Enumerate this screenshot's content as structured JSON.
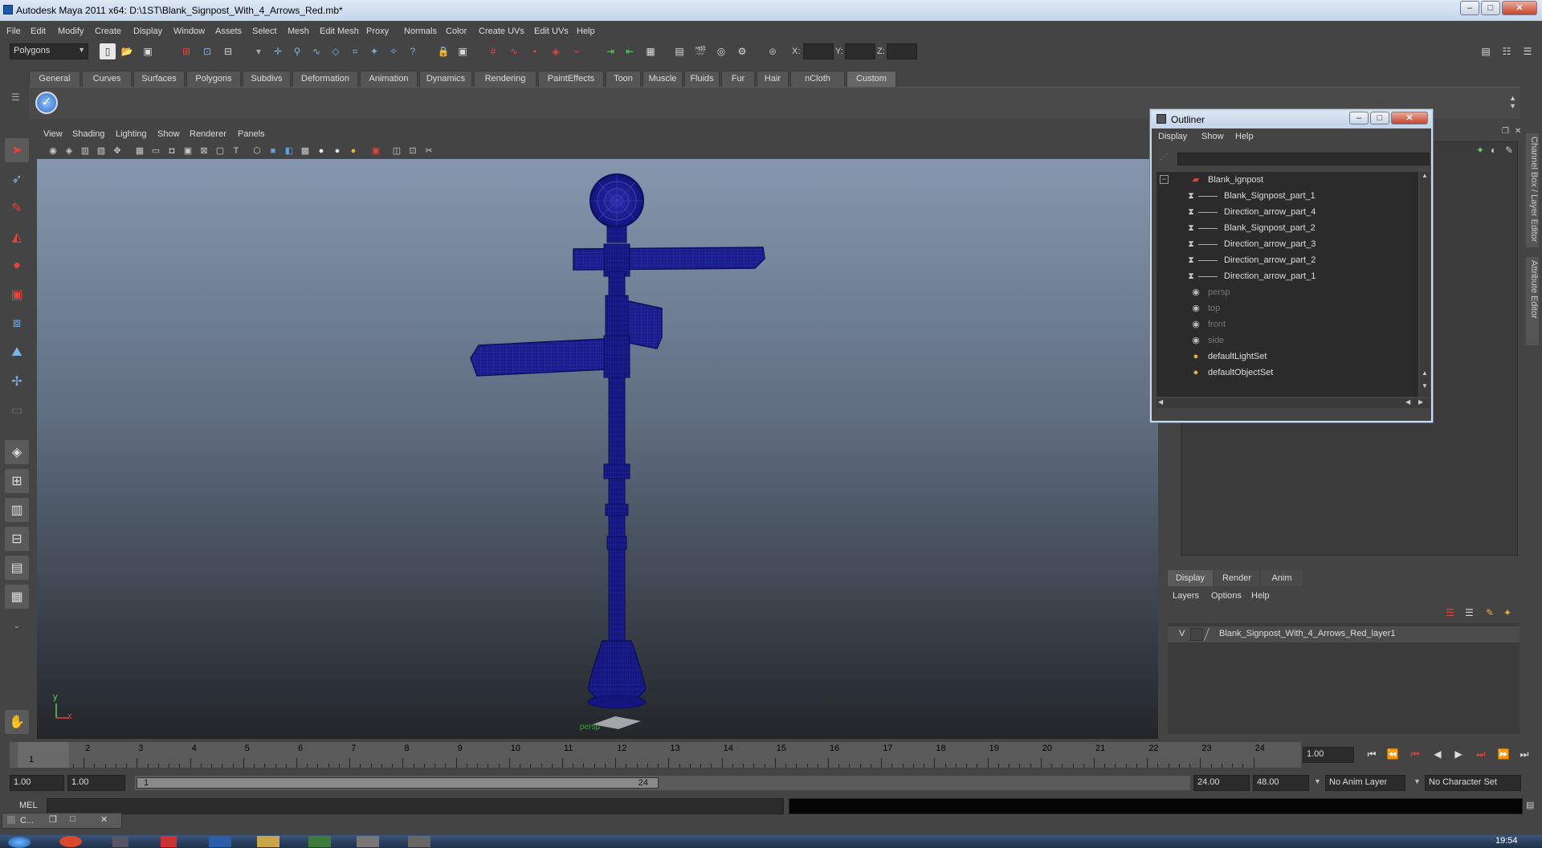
{
  "window": {
    "title": "Autodesk Maya 2011 x64: D:\\1ST\\Blank_Signpost_With_4_Arrows_Red.mb*"
  },
  "menubar": [
    "File",
    "Edit",
    "Modify",
    "Create",
    "Display",
    "Window",
    "Assets",
    "Select",
    "Mesh",
    "Edit Mesh",
    "Proxy",
    "Normals",
    "Color",
    "Create UVs",
    "Edit UVs",
    "Help"
  ],
  "statusline": {
    "mode": "Polygons",
    "x_label": "X:",
    "y_label": "Y:",
    "z_label": "Z:"
  },
  "shelf": {
    "tabs": [
      "General",
      "Curves",
      "Surfaces",
      "Polygons",
      "Subdivs",
      "Deformation",
      "Animation",
      "Dynamics",
      "Rendering",
      "PaintEffects",
      "Toon",
      "Muscle",
      "Fluids",
      "Fur",
      "Hair",
      "nCloth",
      "Custom"
    ],
    "active_tab": "Custom"
  },
  "viewport": {
    "menu": [
      "View",
      "Shading",
      "Lighting",
      "Show",
      "Renderer",
      "Panels"
    ],
    "camera_label": "persp",
    "axis_y": "y",
    "axis_x": "x"
  },
  "outliner": {
    "title": "Outliner",
    "menu": [
      "Display",
      "Show",
      "Help"
    ],
    "items": [
      {
        "label": "Blank_ignpost",
        "depth": 0,
        "dim": false,
        "expand": "−",
        "icon": "group-icon"
      },
      {
        "label": "Blank_Signpost_part_1",
        "depth": 1,
        "dim": false,
        "icon": "mesh-icon"
      },
      {
        "label": "Direction_arrow_part_4",
        "depth": 1,
        "dim": false,
        "icon": "mesh-icon"
      },
      {
        "label": "Blank_Signpost_part_2",
        "depth": 1,
        "dim": false,
        "icon": "mesh-icon"
      },
      {
        "label": "Direction_arrow_part_3",
        "depth": 1,
        "dim": false,
        "icon": "mesh-icon"
      },
      {
        "label": "Direction_arrow_part_2",
        "depth": 1,
        "dim": false,
        "icon": "mesh-icon"
      },
      {
        "label": "Direction_arrow_part_1",
        "depth": 1,
        "dim": false,
        "icon": "mesh-icon"
      },
      {
        "label": "persp",
        "depth": 0,
        "dim": true,
        "icon": "camera-icon"
      },
      {
        "label": "top",
        "depth": 0,
        "dim": true,
        "icon": "camera-icon"
      },
      {
        "label": "front",
        "depth": 0,
        "dim": true,
        "icon": "camera-icon"
      },
      {
        "label": "side",
        "depth": 0,
        "dim": true,
        "icon": "camera-icon"
      },
      {
        "label": "defaultLightSet",
        "depth": 0,
        "dim": false,
        "icon": "set-icon"
      },
      {
        "label": "defaultObjectSet",
        "depth": 0,
        "dim": false,
        "icon": "set-icon"
      }
    ]
  },
  "side_tabs": [
    "Channel Box / Layer Editor",
    "Attribute Editor"
  ],
  "layer_editor": {
    "tabs": [
      "Display",
      "Render",
      "Anim"
    ],
    "active_tab": "Display",
    "menu": [
      "Layers",
      "Options",
      "Help"
    ],
    "layer": {
      "visibility": "V",
      "name": "Blank_Signpost_With_4_Arrows_Red_layer1"
    }
  },
  "timeslider": {
    "ticks": [
      "1",
      "2",
      "3",
      "4",
      "5",
      "6",
      "7",
      "8",
      "9",
      "10",
      "11",
      "12",
      "13",
      "14",
      "15",
      "16",
      "17",
      "18",
      "19",
      "20",
      "21",
      "22",
      "23",
      "24"
    ],
    "current_frame_label": "1",
    "current_time": "1.00"
  },
  "range": {
    "start": "1.00",
    "playback_start": "1.00",
    "handle_start": "1",
    "handle_end": "24",
    "playback_end": "24.00",
    "end": "48.00",
    "anim_layer": "No Anim Layer",
    "character_set": "No Character Set"
  },
  "cmdline": {
    "label": "MEL"
  },
  "taskbar": {
    "minimized_label": "C...",
    "time": "19:54"
  },
  "colors": {
    "wireframe": "#12137a",
    "viewport_top": "#8596ae",
    "viewport_bottom": "#232629",
    "active_tab": "#666666"
  }
}
